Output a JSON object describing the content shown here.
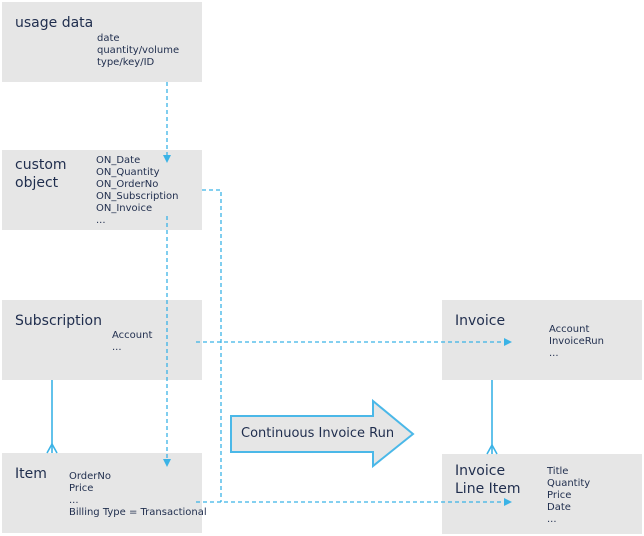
{
  "colors": {
    "box_fill": "#e6e6e6",
    "text": "#1f2d4d",
    "connector": "#3bb3e6",
    "arrow_fill": "#e6e6e6",
    "arrow_stroke": "#4bb8e8"
  },
  "boxes": {
    "usage_data": {
      "title": "usage data",
      "fields": [
        "date",
        "quantity/volume",
        "type/key/ID"
      ]
    },
    "custom_object": {
      "title": "custom\nobject",
      "fields": [
        "ON_Date",
        "ON_Quantity",
        "ON_OrderNo",
        "ON_Subscription",
        "ON_Invoice",
        "..."
      ]
    },
    "subscription": {
      "title": "Subscription",
      "fields": [
        "Account",
        "..."
      ]
    },
    "item": {
      "title": "Item",
      "fields": [
        "OrderNo",
        "Price",
        "...",
        "Billing Type = Transactional"
      ]
    },
    "invoice": {
      "title": "Invoice",
      "fields": [
        "Account",
        "InvoiceRun",
        "..."
      ]
    },
    "invoice_line_item": {
      "title": "Invoice\nLine Item",
      "fields": [
        "Title",
        "Quantity",
        "Price",
        "Date",
        "..."
      ]
    }
  },
  "process_arrow": {
    "label": "Continuous Invoice Run"
  },
  "connectors": [
    {
      "from": "usage_data",
      "to": "custom_object",
      "style": "dashed",
      "arrow": "end"
    },
    {
      "from": "custom_object",
      "to": "item",
      "style": "dashed",
      "arrow": "end"
    },
    {
      "from": "custom_object",
      "to": "invoice_line_item",
      "style": "dashed",
      "arrow": "end"
    },
    {
      "from": "subscription",
      "to": "invoice",
      "style": "dashed",
      "arrow": "end"
    },
    {
      "from": "item",
      "to": "invoice_line_item",
      "style": "dashed",
      "arrow": "end"
    },
    {
      "from": "subscription",
      "to": "item",
      "style": "solid",
      "arrow": "crowsfoot"
    },
    {
      "from": "invoice",
      "to": "invoice_line_item",
      "style": "solid",
      "arrow": "crowsfoot"
    }
  ]
}
